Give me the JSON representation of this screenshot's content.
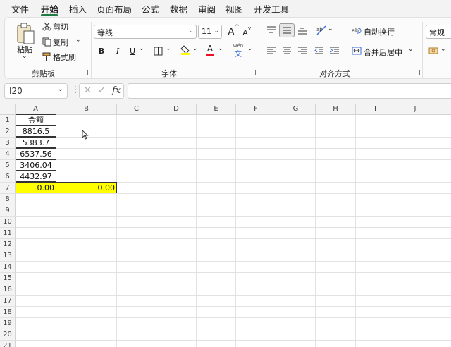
{
  "menu": {
    "items": [
      "文件",
      "开始",
      "插入",
      "页面布局",
      "公式",
      "数据",
      "审阅",
      "视图",
      "开发工具"
    ],
    "active_index": 1
  },
  "ribbon": {
    "clipboard": {
      "paste_label": "粘贴",
      "cut_label": "剪切",
      "copy_label": "复制",
      "format_painter_label": "格式刷",
      "group_label": "剪贴板"
    },
    "font": {
      "font_name": "等线",
      "font_size": "11",
      "grow_label": "A",
      "shrink_label": "A",
      "bold_label": "B",
      "italic_label": "I",
      "underline_label": "U",
      "font_color_label": "A",
      "phonetic_label": "wén",
      "phonetic_char": "文",
      "group_label": "字体"
    },
    "alignment": {
      "wrap_text_label": "自动换行",
      "merge_center_label": "合并后居中",
      "group_label": "对齐方式"
    },
    "number": {
      "format_value": "常规"
    }
  },
  "formula_bar": {
    "name_box": "I20",
    "fx_label": "fx",
    "formula": ""
  },
  "sheet": {
    "columns": [
      "A",
      "B",
      "C",
      "D",
      "E",
      "F",
      "G",
      "H",
      "I",
      "J"
    ],
    "rows": [
      "1",
      "2",
      "3",
      "4",
      "5",
      "6",
      "7",
      "8",
      "9",
      "10",
      "11",
      "12",
      "13",
      "14",
      "15",
      "16",
      "17",
      "18",
      "19",
      "20",
      "21"
    ],
    "header_A1": "金额",
    "amounts": [
      "8816.5",
      "5383.7",
      "6537.56",
      "3406.04",
      "4432.97"
    ],
    "total_A7": "0.00",
    "total_B7": "0.00",
    "highlight_color": "#ffff00"
  },
  "colors": {
    "accent": "#1f7a44",
    "font_color_red": "#e81123",
    "fill_yellow": "#ffff00"
  }
}
